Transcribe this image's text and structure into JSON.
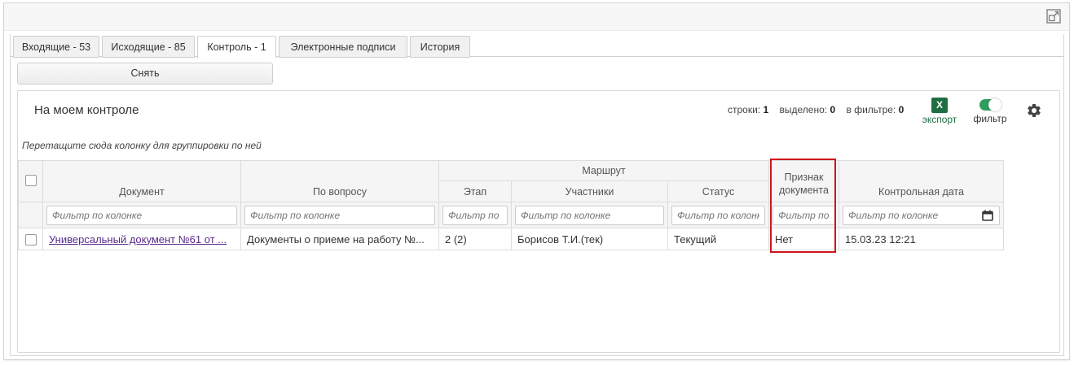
{
  "tabs": [
    {
      "label": "Входящие - 53",
      "active": false
    },
    {
      "label": "Исходящие - 85",
      "active": false
    },
    {
      "label": "Контроль - 1",
      "active": true
    },
    {
      "label": "Электронные подписи",
      "active": false
    },
    {
      "label": "История",
      "active": false
    }
  ],
  "toolbar": {
    "remove_label": "Снять"
  },
  "panel": {
    "title": "На моем контроле",
    "stats": {
      "rows_label": "строки:",
      "rows_value": "1",
      "selected_label": "выделено:",
      "selected_value": "0",
      "filtered_label": "в фильтре:",
      "filtered_value": "0"
    },
    "export_icon_letter": "X",
    "export_label": "экспорт",
    "filter_label": "фильтр",
    "group_hint": "Перетащите сюда колонку для группировки по ней"
  },
  "grid": {
    "group_header": "Маршрут",
    "columns": {
      "document": "Документ",
      "question": "По вопросу",
      "stage": "Этап",
      "participants": "Участники",
      "status": "Статус",
      "sign": "Признак документа",
      "control_date": "Контрольная дата"
    },
    "filter_placeholders": {
      "document": "Фильтр по колонке",
      "question": "Фильтр по колонке",
      "stage": "Фильтр по колонке",
      "participants": "Фильтр по колонке",
      "status": "Фильтр по колонке",
      "sign": "Фильтр по колонке",
      "control_date": "Фильтр по колонке"
    },
    "rows": [
      {
        "document": "Универсальный документ №61 от ...",
        "question": "Документы о приеме на работу №...",
        "stage": "2 (2)",
        "participants": "Борисов Т.И.(тек)",
        "status": "Текущий",
        "sign": "Нет",
        "control_date": "15.03.23 12:21"
      }
    ]
  },
  "colors": {
    "accent_highlight": "#d0141c",
    "excel_green": "#1d6f42",
    "toggle_on": "#2e9e5b",
    "link": "#5a2a8a"
  }
}
